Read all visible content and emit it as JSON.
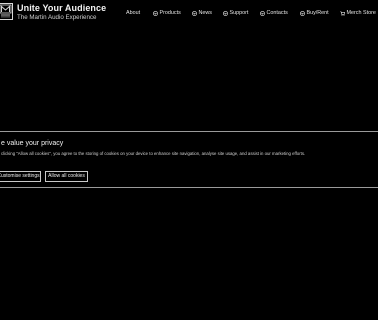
{
  "header": {
    "brand_title": "Unite Your Audience",
    "brand_subtitle": "The Martin Audio Experience",
    "nav": [
      {
        "label": "About",
        "icon": ""
      },
      {
        "label": "Products",
        "icon": "chevron-circle-icon"
      },
      {
        "label": "News",
        "icon": "chevron-circle-icon"
      },
      {
        "label": "Support",
        "icon": "chevron-circle-icon"
      },
      {
        "label": "Contacts",
        "icon": "chevron-circle-icon"
      },
      {
        "label": "Buy/Rent",
        "icon": "chevron-circle-icon"
      },
      {
        "label": "Merch Store",
        "icon": "cart-icon"
      }
    ]
  },
  "cookie_banner": {
    "title": "e value your privacy",
    "text": "clicking \"Allow all cookies\", you agree to the storing of cookies on your device to enhance site navigation, analyse site usage, and assist in our marketing efforts.",
    "customise_label": "Customise settings",
    "allow_label": "Allow all cookies"
  },
  "colors": {
    "background": "#000000",
    "text": "#ffffff",
    "border": "#9a9a9a"
  }
}
